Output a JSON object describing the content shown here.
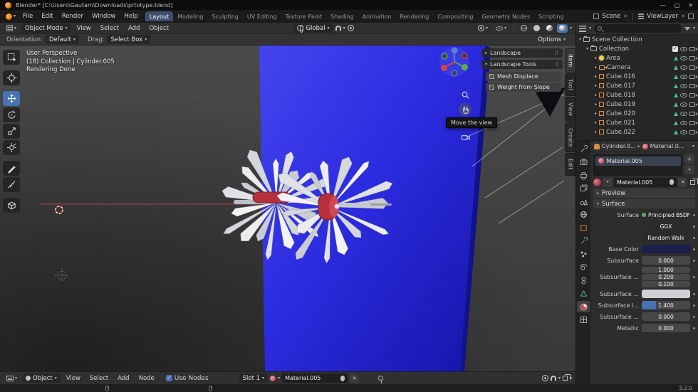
{
  "window": {
    "title": "Blender* [C:\\Users\\Gautam\\Downloads\\prtotype.blend]"
  },
  "colors": {
    "accent": "#4772b3",
    "plane_blue": "#2b2bdc",
    "hub_red": "#b5303c",
    "base_color_swatch": "#1d1d4e",
    "sss_color_swatch": "#cfd0d4"
  },
  "topbar": {
    "menus": [
      "File",
      "Edit",
      "Render",
      "Window",
      "Help"
    ],
    "workspaces": [
      "Layout",
      "Modeling",
      "Sculpting",
      "UV Editing",
      "Texture Paint",
      "Shading",
      "Animation",
      "Rendering",
      "Compositing",
      "Geometry Nodes",
      "Scripting"
    ],
    "active_workspace": "Layout",
    "scene": "Scene",
    "view_layer": "ViewLayer"
  },
  "viewport_header": {
    "mode": "Object Mode",
    "menus": [
      "View",
      "Select",
      "Add",
      "Object"
    ],
    "orientation": "Global"
  },
  "tool_settings": {
    "orientation_label": "Orientation:",
    "orientation_value": "Default",
    "drag_label": "Drag:",
    "drag_value": "Select Box",
    "options_label": "Options"
  },
  "viewport": {
    "overlay": {
      "line1": "User Perspective",
      "line2": "(18) Collection | Cylinder.005",
      "line3": "Rendering Done"
    },
    "landscape_panel": "Landscape",
    "landscape_tools_panel": "Landscape Tools",
    "mesh_displace_button": "Mesh Displace",
    "weight_from_slope_button": "Weight from Slope",
    "tooltip": "Move the view",
    "side_tabs": [
      "Item",
      "Tool",
      "View",
      "Create",
      "Edit"
    ]
  },
  "outliner": {
    "root": "Scene Collection",
    "collection": "Collection",
    "items": [
      "Area",
      "Camera",
      "Cube.016",
      "Cube.017",
      "Cube.018",
      "Cube.019",
      "Cube.020",
      "Cube.021",
      "Cube.022"
    ]
  },
  "properties": {
    "breadcrumb_object": "Cylinder.0...",
    "breadcrumb_material": "Material.0...",
    "slot_name": "Material.005",
    "material_name": "Material.005",
    "preview_section": "Preview",
    "surface_section": "Surface",
    "surface_label": "Surface",
    "surface_shader": "Principled BSDF",
    "distribution": "GGX",
    "sss_method": "Random Walk",
    "base_color_label": "Base Color",
    "subsurface_label": "Subsurface",
    "subsurface_value": "0.000",
    "radius_label": "Subsurface ...",
    "radius_values": [
      "1.000",
      "0.200",
      "0.100"
    ],
    "sss_color_label": "Subsurface ...",
    "ior_label": "Subsurface I...",
    "ior_value": "1.400",
    "aniso_label": "Subsurface ...",
    "aniso_value": "0.000",
    "metallic_label": "Metallic",
    "metallic_value": "0.000"
  },
  "shader_editor": {
    "type": "Object",
    "menus": [
      "View",
      "Select",
      "Add",
      "Node"
    ],
    "use_nodes_label": "Use Nodes",
    "slot_label": "Slot 1",
    "material_name": "Material.005"
  },
  "statusbar": {
    "version": "3.2.0"
  }
}
